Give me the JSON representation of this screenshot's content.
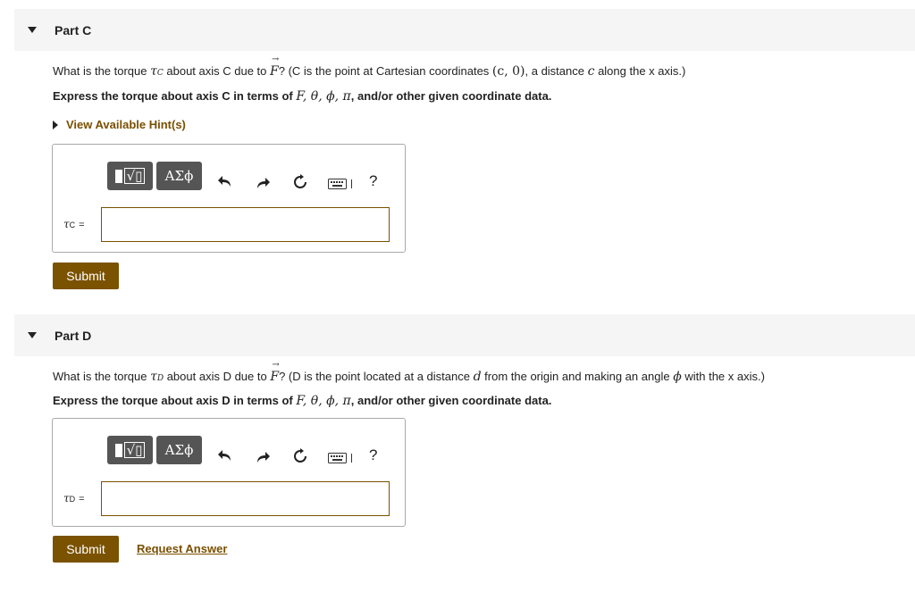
{
  "part_c": {
    "title": "Part C",
    "question": {
      "pre": "What is the torque ",
      "tau": "τ",
      "tau_sub": "C",
      "mid1": " about axis C due to ",
      "force": "F",
      "mid2": "? (C is the point at Cartesian coordinates ",
      "coords": "(c, 0)",
      "mid3": ", a distance ",
      "c": "c",
      "end": " along the x axis.)"
    },
    "instruction": {
      "pre": "Express the torque about axis C in terms of ",
      "vars": "F, θ, ϕ, π",
      "post": ", and/or other given coordinate data."
    },
    "hint_label": "View Available Hint(s)",
    "toolbar": {
      "symbols_label": "ΑΣϕ",
      "help_label": "?"
    },
    "answer_label": {
      "tau": "τ",
      "sub": "C",
      "eq": "="
    },
    "answer_value": "",
    "submit_label": "Submit"
  },
  "part_d": {
    "title": "Part D",
    "question": {
      "pre": "What is the torque ",
      "tau": "τ",
      "tau_sub": "D",
      "mid1": " about axis D due to ",
      "force": "F",
      "mid2": "? (D is the point located at a distance ",
      "d": "d",
      "mid3": " from the origin and making an angle ",
      "phi": "ϕ",
      "end": " with the x axis.)"
    },
    "instruction": {
      "pre": "Express the torque about axis D in terms of ",
      "vars": "F, θ, ϕ, π",
      "post": ", and/or other given coordinate data."
    },
    "toolbar": {
      "symbols_label": "ΑΣϕ",
      "help_label": "?"
    },
    "answer_label": {
      "tau": "τ",
      "sub": "D",
      "eq": "="
    },
    "answer_value": "",
    "submit_label": "Submit",
    "request_answer_label": "Request Answer"
  },
  "colors": {
    "accent": "#7a5200",
    "link": "#7a4f00",
    "header_bg": "#f5f5f5",
    "tool_bg": "#555555"
  }
}
